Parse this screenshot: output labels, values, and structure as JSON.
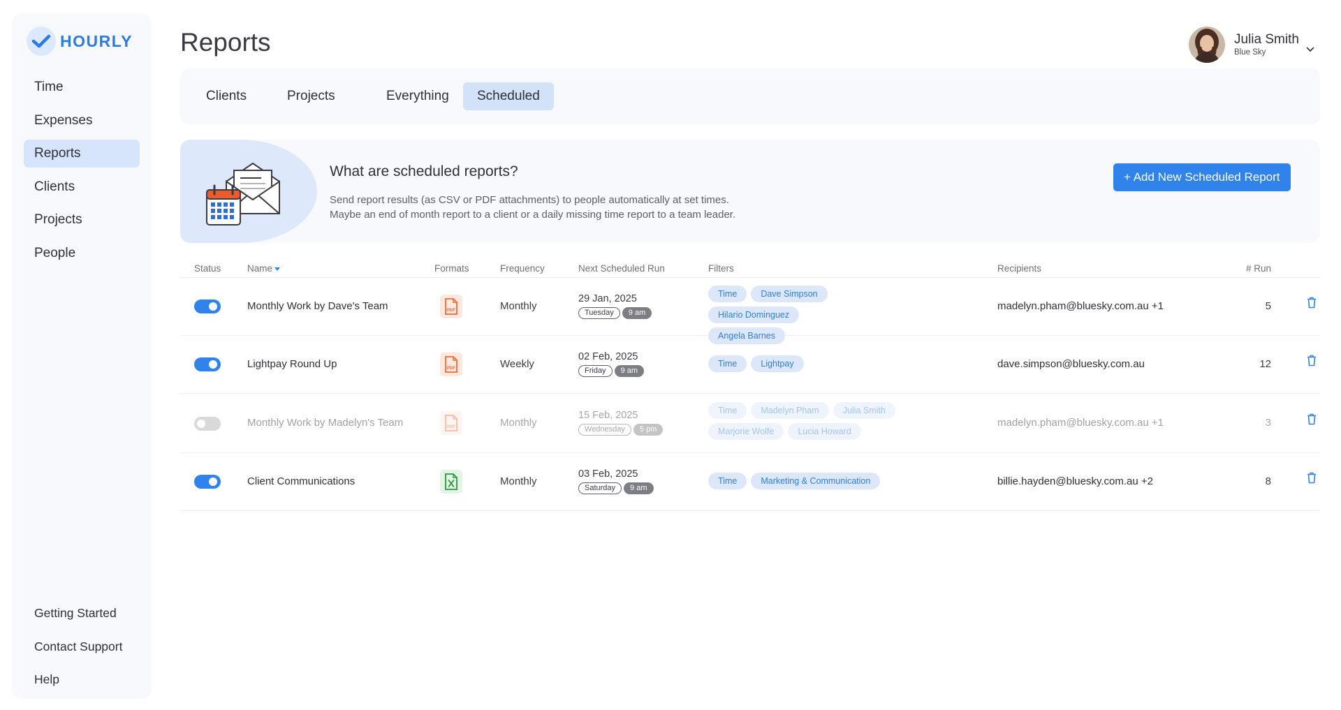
{
  "app": {
    "logo_text": "HOURLY",
    "brand_color": "#2a7be4",
    "accent_color": "#2f83ea"
  },
  "sidebar": {
    "items": [
      {
        "label": "Time"
      },
      {
        "label": "Expenses"
      },
      {
        "label": "Reports",
        "active": true
      },
      {
        "label": "Clients"
      },
      {
        "label": "Projects"
      },
      {
        "label": "People"
      }
    ],
    "bottom_items": [
      {
        "label": "Getting Started"
      },
      {
        "label": "Contact Support"
      },
      {
        "label": "Help"
      }
    ]
  },
  "header": {
    "title": "Reports",
    "user": {
      "name": "Julia Smith",
      "org": "Blue Sky",
      "icon": "chevron-down-icon"
    }
  },
  "tabs": [
    {
      "label": "Clients"
    },
    {
      "label": "Projects"
    },
    {
      "label": "Everything"
    },
    {
      "label": "Scheduled",
      "active": true
    }
  ],
  "banner": {
    "title": "What are scheduled reports?",
    "line1": "Send report results (as CSV or PDF attachments) to people automatically at set times.",
    "line2": "Maybe an end of month report to a client or a daily missing time report to a team leader.",
    "add_button": "+ Add New Scheduled Report",
    "icon": "envelope-calendar-illustration"
  },
  "table": {
    "columns": {
      "status": "Status",
      "name": "Name",
      "formats": "Formats",
      "frequency": "Frequency",
      "next_run": "Next Scheduled Run",
      "filters": "Filters",
      "recipients": "Recipients",
      "run": "# Run"
    },
    "sort": {
      "column": "Name",
      "icon": "caret-down-icon"
    },
    "rows": [
      {
        "enabled": true,
        "name": "Monthly Work by Dave's Team",
        "format": "PDF",
        "frequency": "Monthly",
        "next_date": "29 Jan, 2025",
        "next_day": "Tuesday",
        "next_time": "9 am",
        "filters": [
          "Time",
          "Dave Simpson",
          "Hilario Dominguez",
          "Angela Barnes"
        ],
        "recipients": "madelyn.pham@bluesky.com.au +1",
        "runs": "5"
      },
      {
        "enabled": true,
        "name": "Lightpay Round Up",
        "format": "PDF",
        "frequency": "Weekly",
        "next_date": "02 Feb, 2025",
        "next_day": "Friday",
        "next_time": "9 am",
        "filters": [
          "Time",
          "Lightpay"
        ],
        "recipients": "dave.simpson@bluesky.com.au",
        "runs": "12"
      },
      {
        "enabled": false,
        "name": "Monthly Work by Madelyn's Team",
        "format": "PDF",
        "frequency": "Monthly",
        "next_date": "15 Feb, 2025",
        "next_day": "Wednesday",
        "next_time": "5 pm",
        "filters": [
          "Time",
          "Madelyn Pham",
          "Julia Smith",
          "Marjorie Wolfe",
          "Lucia Howard"
        ],
        "recipients": "madelyn.pham@bluesky.com.au +1",
        "runs": "3"
      },
      {
        "enabled": true,
        "name": "Client Communications",
        "format": "XLS",
        "frequency": "Monthly",
        "next_date": "03 Feb, 2025",
        "next_day": "Saturday",
        "next_time": "9 am",
        "filters": [
          "Time",
          "Marketing & Communication"
        ],
        "recipients": "billie.hayden@bluesky.com.au +2",
        "runs": "8"
      }
    ]
  }
}
